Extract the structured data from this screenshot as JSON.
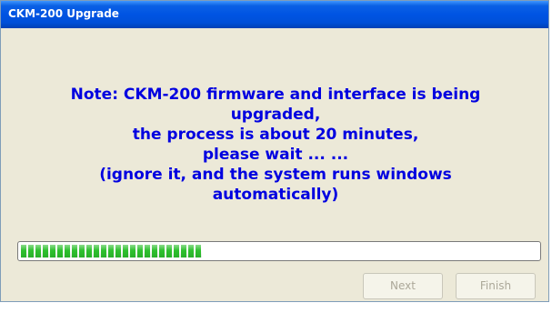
{
  "window": {
    "title": "CKM-200 Upgrade"
  },
  "message": {
    "lines": [
      "Note: CKM-200 firmware and interface is being",
      "upgraded,",
      "the process is about 20 minutes,",
      "please wait ... ...",
      "(ignore it, and the system runs windows",
      "automatically)"
    ],
    "color": "#0000E0"
  },
  "progress": {
    "fraction": 0.35,
    "color": "#2EC02E"
  },
  "buttons": {
    "next_label": "Next",
    "finish_label": "Finish",
    "enabled": false
  }
}
